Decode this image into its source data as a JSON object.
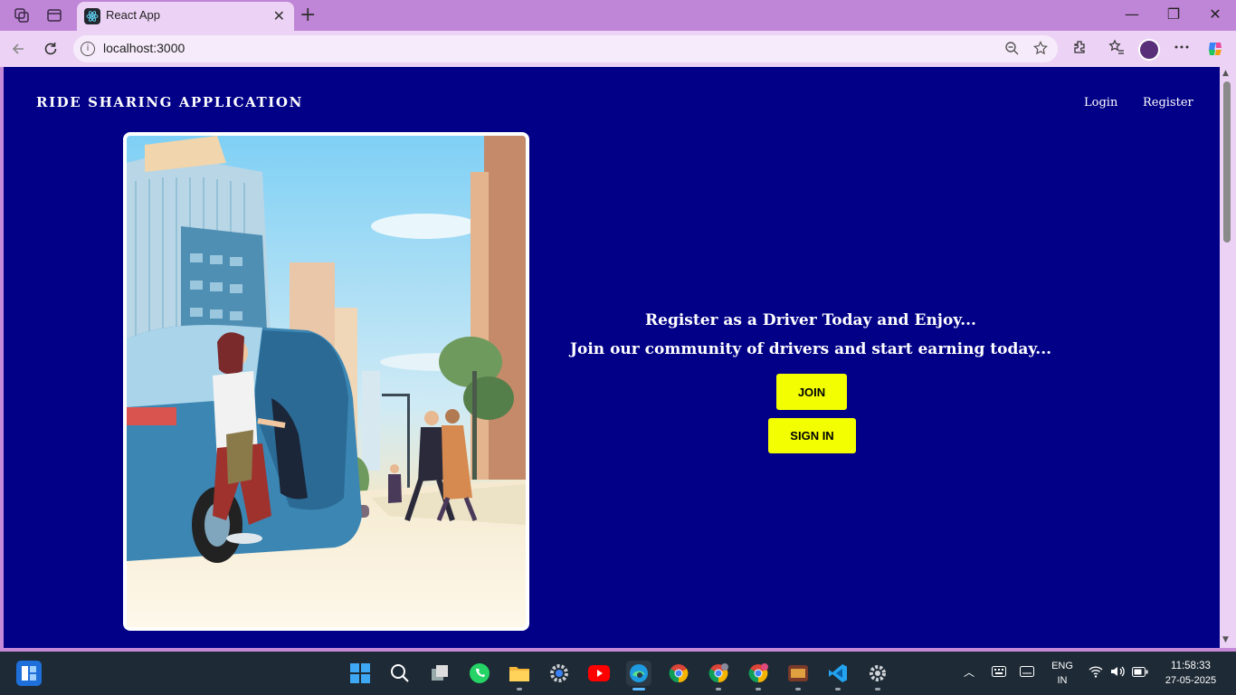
{
  "browser": {
    "tab_title": "React App",
    "tab_close": "✕",
    "new_tab": "+",
    "url": "localhost:3000",
    "window_controls": {
      "minimize": "—",
      "maximize": "❐",
      "close": "✕"
    }
  },
  "page": {
    "brand": "RIDE SHARING APPLICATION",
    "nav": {
      "login": "Login",
      "register": "Register"
    },
    "tagline_1": "Register as a Driver Today and Enjoy...",
    "tagline_2": "Join our community of drivers and start earning today...",
    "join_label": "JOIN",
    "signin_label": "SIGN IN",
    "colors": {
      "background": "#010087",
      "accent": "#f3ff00",
      "text": "#ffffff"
    }
  },
  "taskbar": {
    "language": "ENG",
    "region": "IN",
    "time": "11:58:33",
    "date": "27-05-2025",
    "apps": [
      "start-icon",
      "search-icon",
      "task-view-icon",
      "whatsapp-icon",
      "file-explorer-icon",
      "settings-icon",
      "youtube-icon",
      "edge-icon",
      "chrome-icon",
      "chrome-profile-icon",
      "chrome-notify-icon",
      "app-icon",
      "vscode-icon",
      "settings-gear-icon"
    ]
  }
}
